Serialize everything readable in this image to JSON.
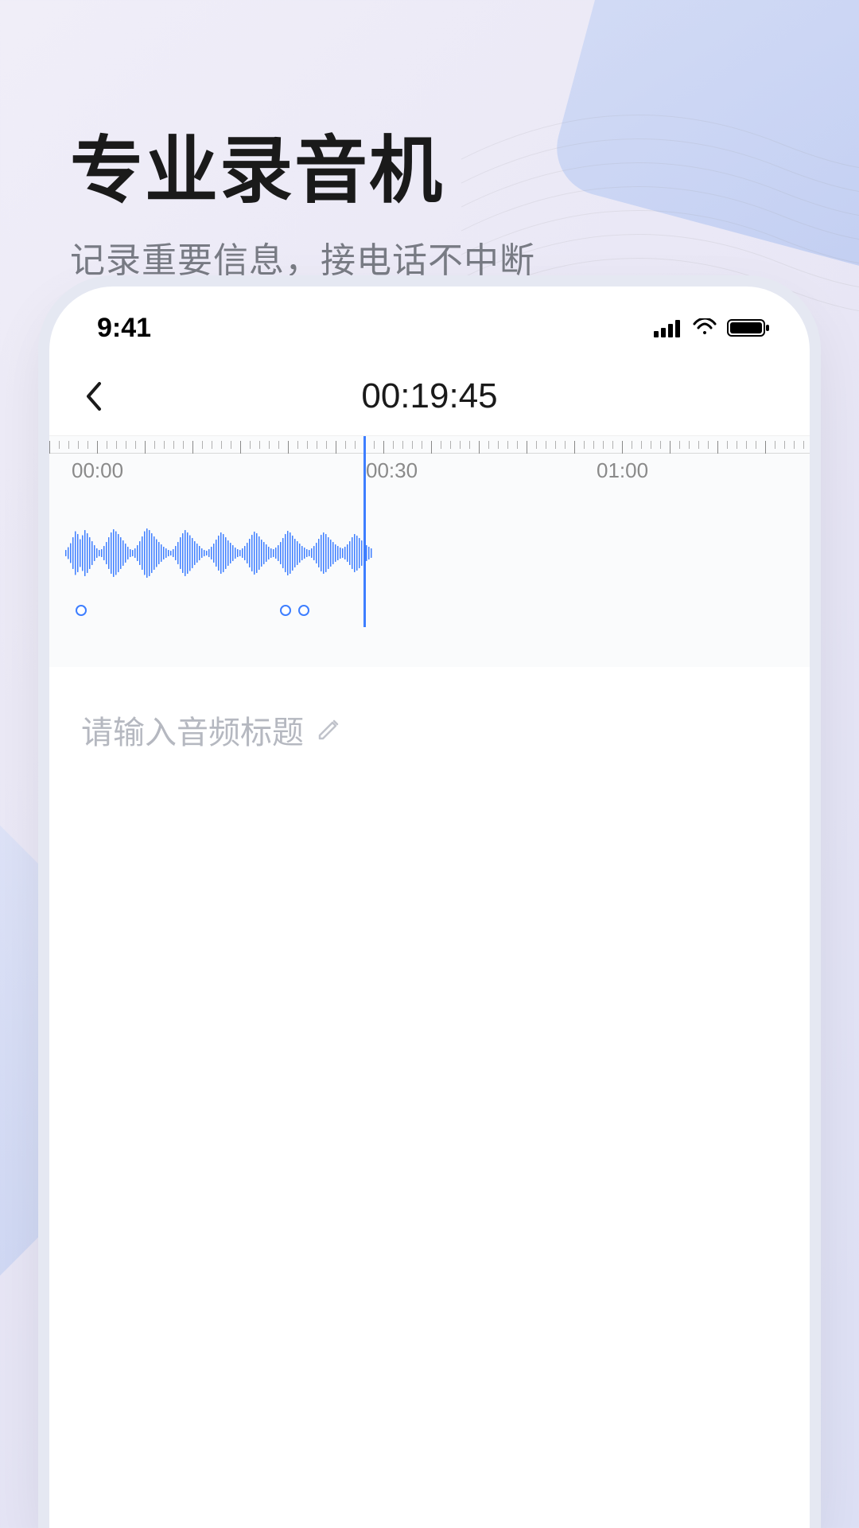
{
  "header": {
    "title": "专业录音机",
    "subtitle": "记录重要信息，接电话不中断"
  },
  "status_bar": {
    "time": "9:41"
  },
  "recorder": {
    "timer": "00:19:45",
    "time_labels": [
      "00:00",
      "00:30",
      "01:00"
    ],
    "title_placeholder": "请输入音频标题"
  },
  "icons": {
    "signal": "signal-icon",
    "wifi": "wifi-icon",
    "battery": "battery-icon",
    "back": "chevron-left-icon",
    "edit": "pencil-icon"
  }
}
